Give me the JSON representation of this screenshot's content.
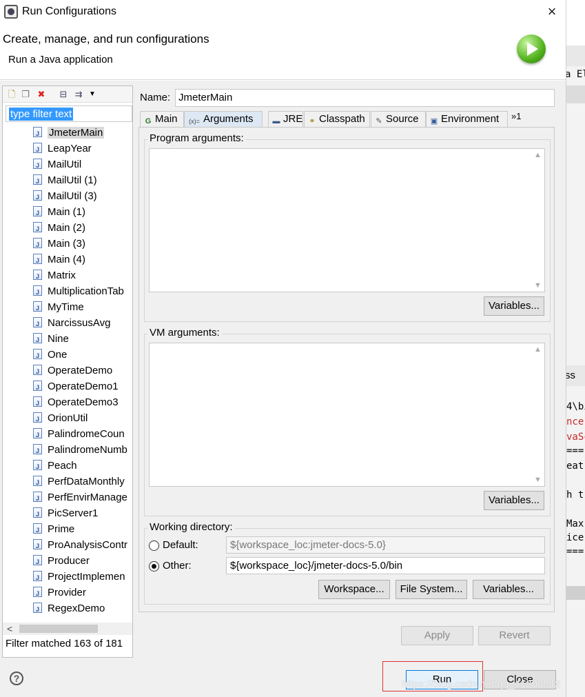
{
  "window": {
    "title": "Run Configurations",
    "close_glyph": "×"
  },
  "header": {
    "title": "Create, manage, and run configurations",
    "subtitle": "Run a Java application",
    "icon": "run-green-icon"
  },
  "left": {
    "filter_text": "type filter text",
    "items": [
      "JmeterMain",
      "LeapYear",
      "MailUtil",
      "MailUtil (1)",
      "MailUtil (3)",
      "Main (1)",
      "Main (2)",
      "Main (3)",
      "Main (4)",
      "Matrix",
      "MultiplicationTab",
      "MyTime",
      "NarcissusAvg",
      "Nine",
      "One",
      "OperateDemo",
      "OperateDemo1",
      "OperateDemo3",
      "OrionUtil",
      "PalindromeCoun",
      "PalindromeNumb",
      "Peach",
      "PerfDataMonthly",
      "PerfEnvirManage",
      "PicServer1",
      "Prime",
      "ProAnalysisContr",
      "Producer",
      "ProjectImplemen",
      "Provider",
      "RegexDemo"
    ],
    "selected": "JmeterMain",
    "scroll_left_glyph": "<",
    "status": "Filter matched 163 of 181"
  },
  "name": {
    "label": "Name:",
    "value": "JmeterMain"
  },
  "tabs": [
    {
      "label": "Main",
      "icon": "main-class-icon",
      "glyph": "G"
    },
    {
      "label": "Arguments",
      "icon": "arguments-icon",
      "glyph": "(x)="
    },
    {
      "label": "JRE",
      "icon": "jre-icon",
      "glyph": "▬"
    },
    {
      "label": "Classpath",
      "icon": "classpath-icon",
      "glyph": "⚭"
    },
    {
      "label": "Source",
      "icon": "source-icon",
      "glyph": "✎"
    },
    {
      "label": "Environment",
      "icon": "environment-icon",
      "glyph": "▣"
    }
  ],
  "tab_overflow": "»1",
  "arguments": {
    "program_label": "Program arguments:",
    "vm_label": "VM arguments:",
    "variables": "Variables...",
    "working_dir_label": "Working directory:",
    "default_label": "Default:",
    "default_value": "${workspace_loc:jmeter-docs-5.0}",
    "other_label": "Other:",
    "other_value": "${workspace_loc}/jmeter-docs-5.0/bin",
    "workspace": "Workspace...",
    "file_system": "File System..."
  },
  "buttons": {
    "apply": "Apply",
    "revert": "Revert",
    "run": "Run",
    "close": "Close",
    "help": "?"
  },
  "watermark": "https://blog.csdn.net/qq_41208942",
  "background_editor": {
    "lines": [
      "a El",
      "ss",
      "4\\bi",
      "nce",
      "vaSc",
      "===",
      "eat",
      "h t",
      "Max",
      "ice",
      "==="
    ]
  }
}
